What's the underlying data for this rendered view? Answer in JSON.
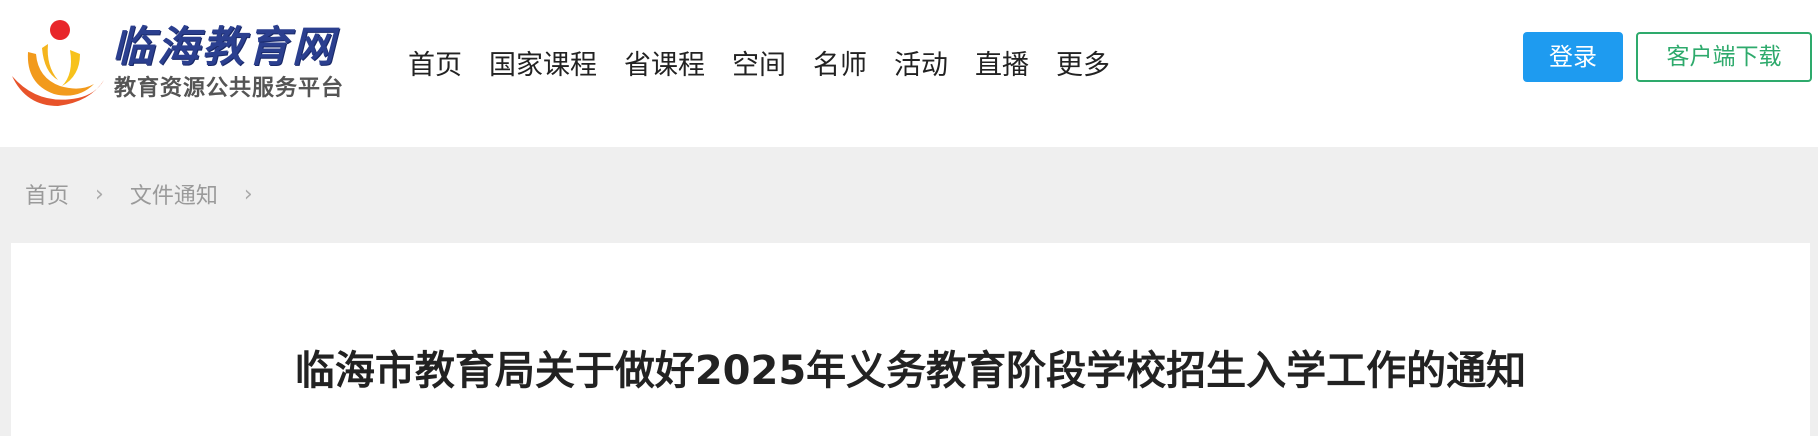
{
  "header": {
    "logo": {
      "title": "临海教育网",
      "subtitle": "教育资源公共服务平台"
    },
    "nav": [
      {
        "label": "首页"
      },
      {
        "label": "国家课程"
      },
      {
        "label": "省课程"
      },
      {
        "label": "空间"
      },
      {
        "label": "名师"
      },
      {
        "label": "活动"
      },
      {
        "label": "直播"
      },
      {
        "label": "更多"
      }
    ],
    "login_label": "登录",
    "download_label": "客户端下载"
  },
  "breadcrumb": {
    "items": [
      {
        "label": "首页"
      },
      {
        "label": "文件通知"
      }
    ],
    "separator_icon": "chevron-right-icon"
  },
  "article": {
    "title": "临海市教育局关于做好2025年义务教育阶段学校招生入学工作的通知"
  },
  "colors": {
    "login_bg": "#1e9bf0",
    "download_border": "#2eaa6c",
    "logo_title": "#2b3f8f",
    "page_bg": "#efefef"
  }
}
